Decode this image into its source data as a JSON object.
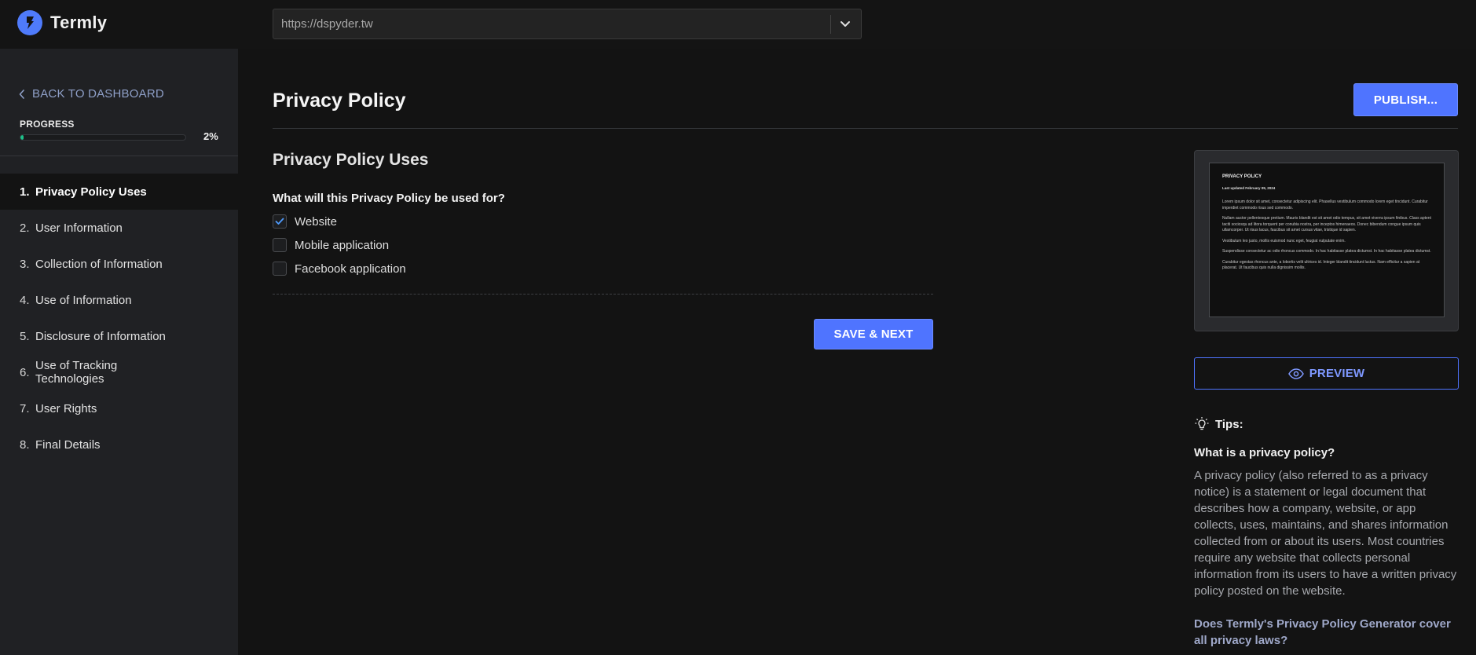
{
  "app": {
    "name": "Termly",
    "brand_color": "#4f7bfb"
  },
  "header": {
    "url_value": "https://dspyder.tw"
  },
  "sidebar": {
    "back_label": "BACK TO DASHBOARD",
    "progress_label": "PROGRESS",
    "progress_percent_text": "2%",
    "progress_value": 0.02,
    "progress_color": "#1ec28b",
    "steps": [
      {
        "num": "1.",
        "label": "Privacy Policy Uses",
        "active": true
      },
      {
        "num": "2.",
        "label": "User Information",
        "active": false
      },
      {
        "num": "3.",
        "label": "Collection of Information",
        "active": false
      },
      {
        "num": "4.",
        "label": "Use of Information",
        "active": false
      },
      {
        "num": "5.",
        "label": "Disclosure of Information",
        "active": false
      },
      {
        "num": "6.",
        "label": "Use of Tracking Technologies",
        "active": false
      },
      {
        "num": "7.",
        "label": "User Rights",
        "active": false
      },
      {
        "num": "8.",
        "label": "Final Details",
        "active": false
      }
    ]
  },
  "main": {
    "page_title": "Privacy Policy",
    "publish_label": "PUBLISH...",
    "section_title": "Privacy Policy Uses",
    "question": "What will this Privacy Policy be used for?",
    "options": [
      {
        "label": "Website",
        "checked": true
      },
      {
        "label": "Mobile application",
        "checked": false
      },
      {
        "label": "Facebook application",
        "checked": false
      }
    ],
    "save_label": "SAVE & NEXT",
    "accent_color": "#4f74ff"
  },
  "preview": {
    "doc_title": "PRIVACY POLICY",
    "doc_updated": "Last updated February 09, 2024",
    "doc_paragraphs": [
      "Lorem ipsum dolor sit amet, consectetur adipiscing elit. Phasellus vestibulum commodo lorem eget tincidunt. Curabitur imperdiet commodo risus sed commodo.",
      "Nullam auctor pellentesque pretium. Mauris blandit est sit amet odio tempus, sit amet viverra ipsum finibus. Class aptent taciti sociosqu ad litora torquent per conubia nostra, per inceptos himenaeos. Donec bibendum congue ipsum quis ullamcorper. Ut risus lacus, faucibus sit amet cursus vitae, tristique id sapien.",
      "Vestibulum leo justo, mollis euismod nunc eget, feugiat vulputate enim.",
      "Suspendisse consectetur ac odio rhoncus commodo. In hac habitasse platea dictumst. In hac habitasse platea dictumst.",
      "Curabitur egestas rhoncus ante, a lobortis velit ultrices id. Integer blandit tincidunt luctus. Nam efficitur a sapien at placerat. Ut faucibus quis nulla dignissim mollis."
    ],
    "preview_label": "PREVIEW"
  },
  "tips": {
    "heading": "Tips:",
    "q1": "What is a privacy policy?",
    "a1": "A privacy policy (also referred to as a privacy notice) is a statement or legal document that describes how a company, website, or app collects, uses, maintains, and shares information collected from or about its users. Most countries require any website that collects personal information from its users to have a written privacy policy posted on the website.",
    "q2": "Does Termly's Privacy Policy Generator cover all privacy laws?"
  }
}
